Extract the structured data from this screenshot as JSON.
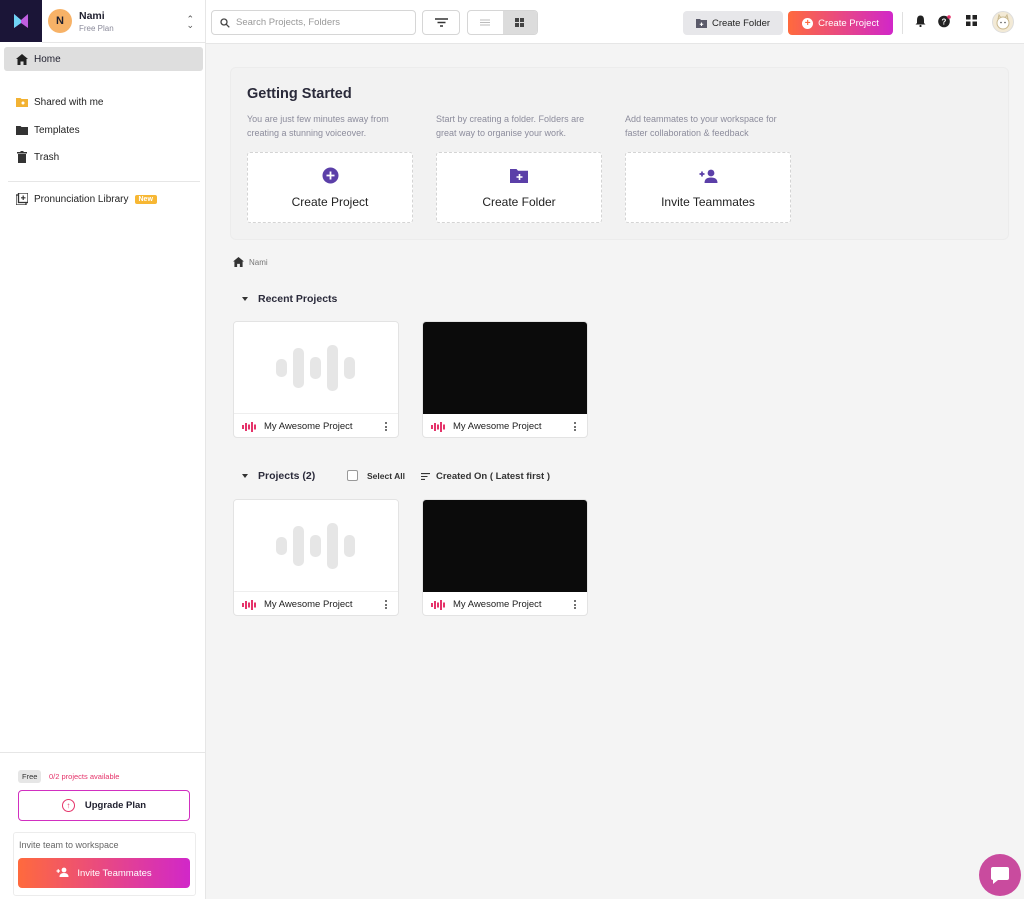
{
  "workspace": {
    "initial": "N",
    "name": "Nami",
    "plan": "Free Plan"
  },
  "sidebar": {
    "home": "Home",
    "items": [
      {
        "label": "Shared with me",
        "icon": "shared-folder-icon"
      },
      {
        "label": "Templates",
        "icon": "folder-icon"
      },
      {
        "label": "Trash",
        "icon": "trash-icon"
      }
    ],
    "pronunciation": {
      "label": "Pronunciation Library",
      "badge": "New"
    },
    "free_tag": "Free",
    "projects_available": "0/2 projects available",
    "upgrade": "Upgrade Plan",
    "invite_text": "Invite team to workspace",
    "invite_button": "Invite Teammates"
  },
  "topbar": {
    "search_placeholder": "Search Projects, Folders",
    "create_folder": "Create Folder",
    "create_project": "Create Project"
  },
  "getting_started": {
    "title": "Getting Started",
    "cards": [
      {
        "desc": "You are just few minutes away from creating a stunning voiceover.",
        "label": "Create Project",
        "icon": "plus-circle-icon"
      },
      {
        "desc": "Start by creating a folder. Folders are great way to organise your work.",
        "label": "Create Folder",
        "icon": "folder-plus-icon"
      },
      {
        "desc": "Add teammates to your workspace for faster collaboration & feedback",
        "label": "Invite Teammates",
        "icon": "add-person-icon"
      }
    ]
  },
  "breadcrumb": "Nami",
  "recent": {
    "title": "Recent Projects",
    "projects": [
      {
        "name": "My Awesome Project",
        "thumb": "waveform"
      },
      {
        "name": "My Awesome Project",
        "thumb": "black"
      }
    ]
  },
  "projects": {
    "title": "Projects (2)",
    "select_all": "Select All",
    "sort": "Created On ( Latest first )",
    "items": [
      {
        "name": "My Awesome Project",
        "thumb": "waveform"
      },
      {
        "name": "My Awesome Project",
        "thumb": "black"
      }
    ]
  },
  "colors": {
    "accent_start": "#ff6a3d",
    "accent_end": "#d127c9",
    "logo_bg": "#1b1537",
    "icon_purple": "#5b3fa8",
    "wave_pink": "#e5336a"
  }
}
